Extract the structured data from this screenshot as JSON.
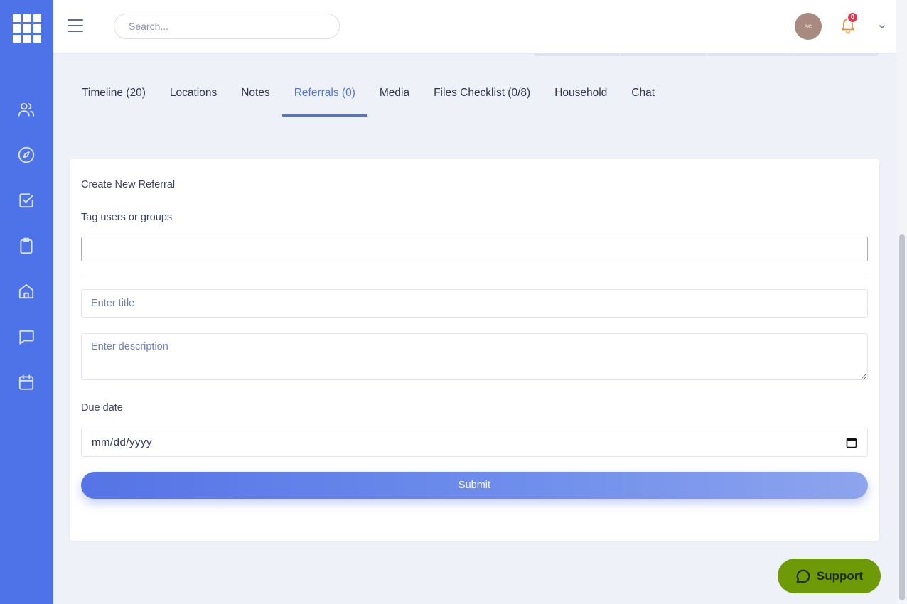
{
  "header": {
    "search_placeholder": "Search...",
    "avatar_initials": "sc",
    "notification_count": "0"
  },
  "sidebar": {
    "items": [
      {
        "icon": "users-icon"
      },
      {
        "icon": "compass-icon"
      },
      {
        "icon": "checkbox-icon"
      },
      {
        "icon": "clipboard-icon"
      },
      {
        "icon": "home-icon"
      },
      {
        "icon": "chat-icon"
      },
      {
        "icon": "calendar-icon"
      }
    ]
  },
  "tabs": [
    {
      "label": "Timeline (20)",
      "active": false
    },
    {
      "label": "Locations",
      "active": false
    },
    {
      "label": "Notes",
      "active": false
    },
    {
      "label": "Referrals (0)",
      "active": true
    },
    {
      "label": "Media",
      "active": false
    },
    {
      "label": "Files Checklist (0/8)",
      "active": false
    },
    {
      "label": "Household",
      "active": false
    },
    {
      "label": "Chat",
      "active": false
    }
  ],
  "form": {
    "title": "Create New Referral",
    "tag_label": "Tag users or groups",
    "tag_value": "",
    "title_placeholder": "Enter title",
    "description_placeholder": "Enter description",
    "due_label": "Due date",
    "due_value": "mm/dd/yyyy",
    "submit_label": "Submit"
  },
  "support": {
    "label": "Support"
  },
  "colors": {
    "sidebar": "#4e73e8",
    "accent": "#4f72e3",
    "support": "#6e9a07",
    "badge": "#e8344d",
    "bell": "#f28c28"
  }
}
